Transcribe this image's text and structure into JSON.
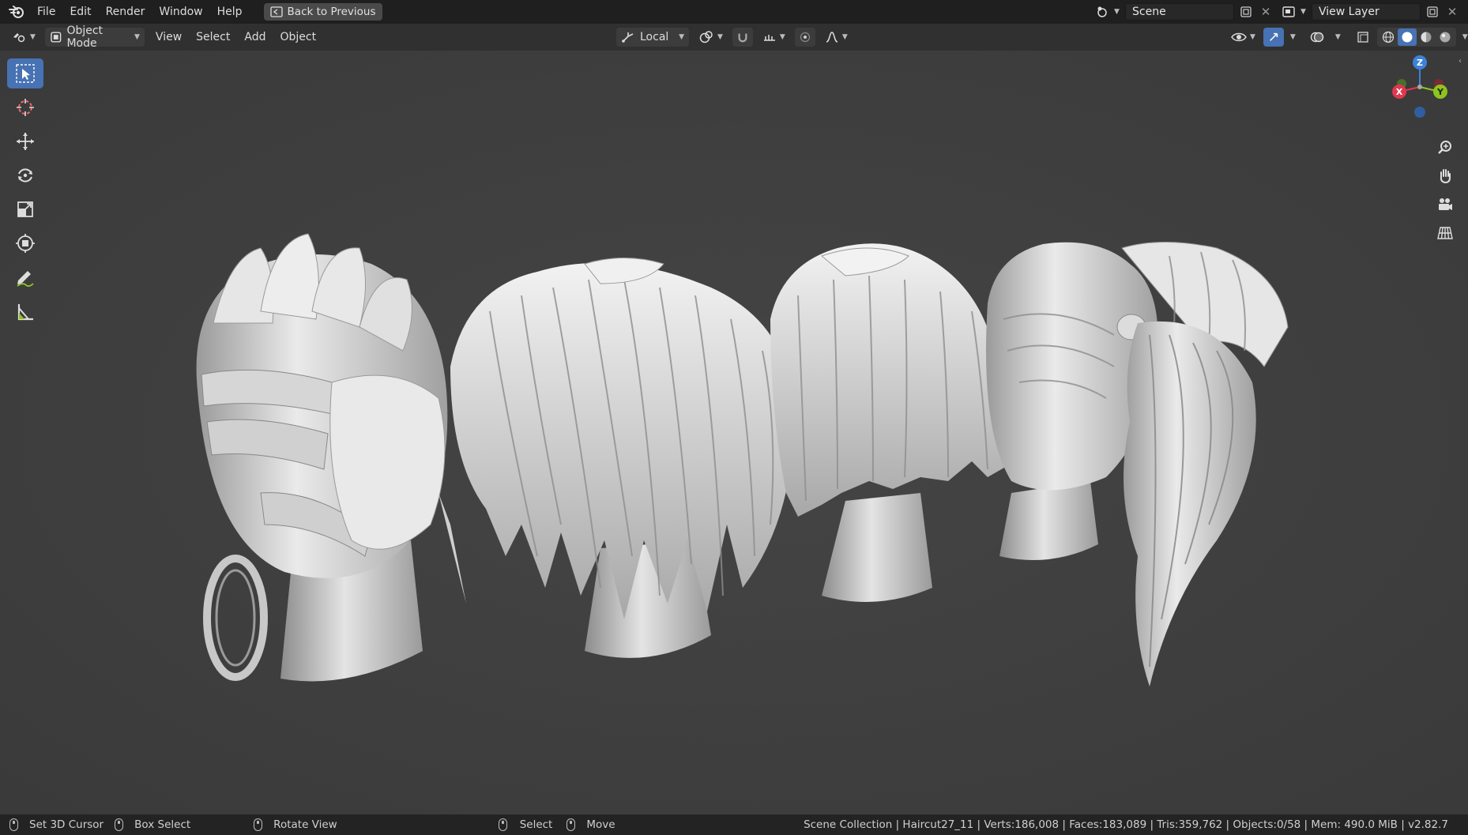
{
  "menu": {
    "items": [
      "File",
      "Edit",
      "Render",
      "Window",
      "Help"
    ],
    "back_button": "Back to Previous",
    "scene_label": "Scene",
    "view_layer_label": "View Layer"
  },
  "header": {
    "mode": "Object Mode",
    "menus": [
      "View",
      "Select",
      "Add",
      "Object"
    ],
    "orientation": "Local"
  },
  "tools": [
    {
      "name": "select-box-tool",
      "icon": "cursor-select-icon"
    },
    {
      "name": "cursor-tool",
      "icon": "3d-cursor-icon"
    },
    {
      "name": "move-tool",
      "icon": "move-icon"
    },
    {
      "name": "rotate-tool",
      "icon": "rotate-icon"
    },
    {
      "name": "scale-tool",
      "icon": "scale-icon"
    },
    {
      "name": "transform-tool",
      "icon": "transform-icon"
    },
    {
      "name": "annotate-tool",
      "icon": "annotate-icon"
    },
    {
      "name": "measure-tool",
      "icon": "measure-icon"
    }
  ],
  "gizmo": {
    "x": "X",
    "y": "Y",
    "z": "Z"
  },
  "status": {
    "left": [
      "Set 3D Cursor",
      "Box Select",
      "Rotate View",
      "Select",
      "Move"
    ],
    "info": "Scene Collection | Haircut27_11 | Verts:186,008 | Faces:183,089 | Tris:359,762 | Objects:0/58 | Mem: 490.0 MiB | v2.82.7"
  },
  "colors": {
    "accent": "#4772b3",
    "x_axis": "#e0384f",
    "y_axis": "#8fc31f",
    "z_axis": "#3d82d8"
  }
}
